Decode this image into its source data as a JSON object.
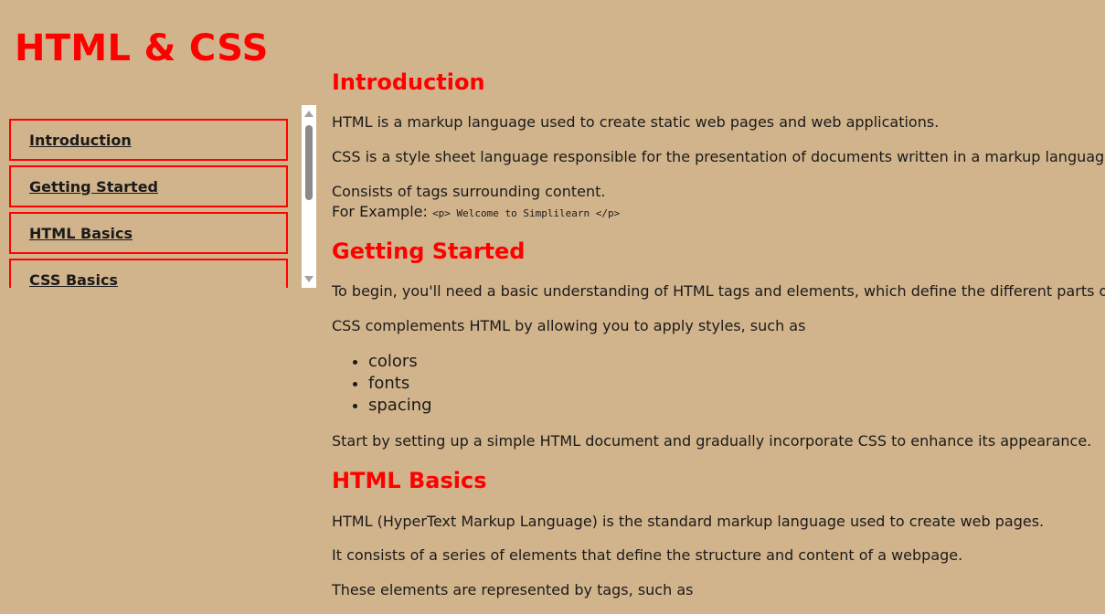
{
  "site": {
    "title": "HTML & CSS"
  },
  "nav": {
    "items": [
      {
        "label": "Introduction"
      },
      {
        "label": "Getting Started"
      },
      {
        "label": "HTML Basics"
      },
      {
        "label": "CSS Basics"
      }
    ]
  },
  "content": {
    "introduction": {
      "title": "Introduction",
      "p1": "HTML is a markup language used to create static web pages and web applications.",
      "p2": "CSS is a style sheet language responsible for the presentation of documents written in a markup language.",
      "p3_line1": "Consists of tags surrounding content.",
      "p3_line2_prefix": "For Example: ",
      "p3_code": "<p> Welcome to Simplilearn </p>"
    },
    "getting_started": {
      "title": "Getting Started",
      "p1": "To begin, you'll need a basic understanding of HTML tags and elements, which define the different parts of your w",
      "p2": "CSS complements HTML by allowing you to apply styles, such as",
      "bullets": [
        "colors",
        "fonts",
        "spacing"
      ],
      "p3": "Start by setting up a simple HTML document and gradually incorporate CSS to enhance its appearance."
    },
    "html_basics": {
      "title": "HTML Basics",
      "p1": "HTML (HyperText Markup Language) is the standard markup language used to create web pages.",
      "p2": "It consists of a series of elements that define the structure and content of a webpage.",
      "p3": "These elements are represented by tags, such as"
    }
  },
  "colors": {
    "background": "#D2B48C",
    "accent": "#FF0000",
    "text": "#1A1A1A"
  }
}
